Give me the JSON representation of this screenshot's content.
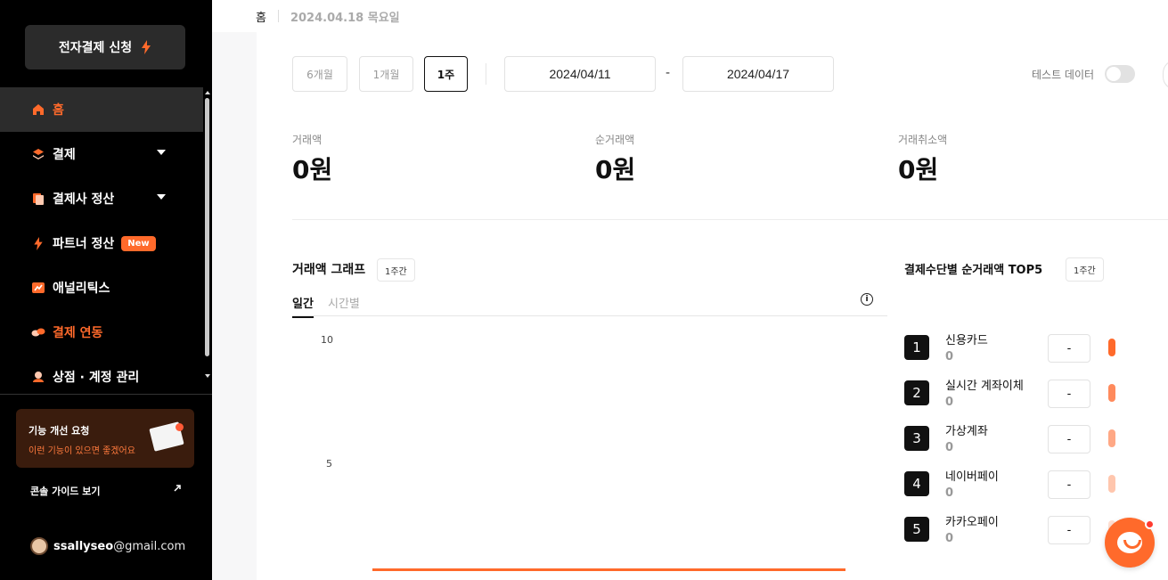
{
  "sidebar": {
    "apply_button": "전자결제 신청",
    "items": [
      {
        "label": "홈"
      },
      {
        "label": "결제"
      },
      {
        "label": "결제사 정산"
      },
      {
        "label": "파트너 정산",
        "badge": "New"
      },
      {
        "label": "애널리틱스"
      },
      {
        "label": "결제 연동"
      },
      {
        "label": "상점 · 계정 관리"
      }
    ],
    "feedback": {
      "title": "기능 개선 요청",
      "subtitle": "이런 기능이 있으면 좋겠어요"
    },
    "guide_link": "콘솔 가이드 보기",
    "user": {
      "name": "ssallyseo",
      "domain": "@gmail.com"
    }
  },
  "header": {
    "breadcrumb_home": "홈",
    "date": "2024.04.18 목요일"
  },
  "filters": {
    "periods": [
      "6개월",
      "1개월",
      "1주"
    ],
    "active_period": "1주",
    "start_date": "2024/04/11",
    "end_date": "2024/04/17",
    "separator": "-",
    "test_data_label": "테스트 데이터",
    "test_data_enabled": false
  },
  "metrics": [
    {
      "label": "거래액",
      "value": "0원"
    },
    {
      "label": "순거래액",
      "value": "0원"
    },
    {
      "label": "거래취소액",
      "value": "0원"
    }
  ],
  "graph": {
    "title": "거래액 그래프",
    "chip": "1주간",
    "tabs": [
      "일간",
      "시간별"
    ],
    "active_tab": "일간",
    "y_ticks": [
      "10",
      "5"
    ],
    "line_color": "#ff6a2b"
  },
  "top5": {
    "title": "결제수단별 순거래액 TOP5",
    "chip": "1주간",
    "items": [
      {
        "rank": "1",
        "name": "신용카드",
        "value": "0",
        "box": "-",
        "color": "#ff6a2b"
      },
      {
        "rank": "2",
        "name": "실시간 계좌이체",
        "value": "0",
        "box": "-",
        "color": "#ff8a5c"
      },
      {
        "rank": "3",
        "name": "가상계좌",
        "value": "0",
        "box": "-",
        "color": "#ffa885"
      },
      {
        "rank": "4",
        "name": "네이버페이",
        "value": "0",
        "box": "-",
        "color": "#ffc6ad"
      },
      {
        "rank": "5",
        "name": "카카오페이",
        "value": "0",
        "box": "-",
        "color": "#ffe0d3"
      }
    ]
  },
  "colors": {
    "accent": "#ff6a2b",
    "sidebar_bg": "#000000"
  }
}
